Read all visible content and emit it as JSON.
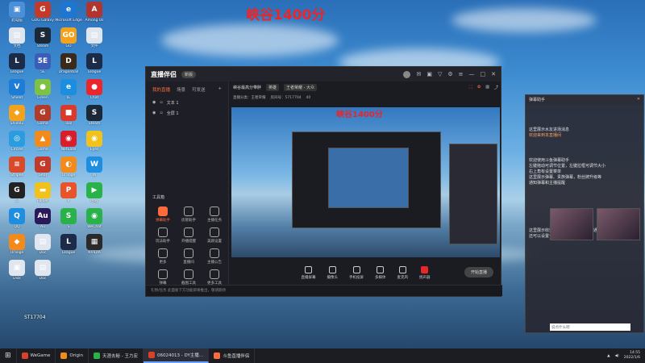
{
  "overlay_title": "峡谷1400分",
  "watermark": "ST17704",
  "desktop_icons": [
    {
      "label": "此电脑",
      "color": "#4a8fd8",
      "glyph": "▣"
    },
    {
      "label": "GOG Galaxy",
      "color": "#c23b2a",
      "glyph": "G"
    },
    {
      "label": "Microsoft Edge",
      "color": "#1d76cf",
      "glyph": "e"
    },
    {
      "label": "Among Us",
      "color": "#b2342e",
      "glyph": "A"
    },
    {
      "label": "文档",
      "color": "#e0e6ef",
      "glyph": "▤"
    },
    {
      "label": "Steam",
      "color": "#1b2838",
      "glyph": "S"
    },
    {
      "label": "GO",
      "color": "#f2a21c",
      "glyph": "GO"
    },
    {
      "label": "文件",
      "color": "#e0e6ef",
      "glyph": "▤"
    },
    {
      "label": "League",
      "color": "#1c2b48",
      "glyph": "L"
    },
    {
      "label": "5E",
      "color": "#3b5db8",
      "glyph": "5E"
    },
    {
      "label": "Dragonball",
      "color": "#3a2a1a",
      "glyph": "D"
    },
    {
      "label": "League",
      "color": "#1c2b48",
      "glyph": "L"
    },
    {
      "label": "Shield",
      "color": "#1c7cd6",
      "glyph": "V"
    },
    {
      "label": "Green",
      "color": "#7dc244",
      "glyph": "●"
    },
    {
      "label": "IE",
      "color": "#1b8ee0",
      "glyph": "e"
    },
    {
      "label": "Chat",
      "color": "#e8262b",
      "glyph": "●"
    },
    {
      "label": "Shield2",
      "color": "#f2a21c",
      "glyph": "◆"
    },
    {
      "label": "Game",
      "color": "#b23a2a",
      "glyph": "G"
    },
    {
      "label": "Tool",
      "color": "#d93a2b",
      "glyph": "■"
    },
    {
      "label": "Steam",
      "color": "#1b2838",
      "glyph": "S"
    },
    {
      "label": "Circles",
      "color": "#2a9cdf",
      "glyph": "◎"
    },
    {
      "label": "Game",
      "color": "#f28a1c",
      "glyph": "▲"
    },
    {
      "label": "NetEase",
      "color": "#d81e2a",
      "glyph": "◉"
    },
    {
      "label": "Eyes",
      "color": "#f2c21c",
      "glyph": "◉"
    },
    {
      "label": "Stripes",
      "color": "#d84a2a",
      "glyph": "≡"
    },
    {
      "label": "Gear",
      "color": "#c23b2a",
      "glyph": "G"
    },
    {
      "label": "Orange",
      "color": "#f28a1c",
      "glyph": "◐"
    },
    {
      "label": "W",
      "color": "#1d8ee0",
      "glyph": "W"
    },
    {
      "label": "G",
      "color": "#222",
      "glyph": "G"
    },
    {
      "label": "Folder",
      "color": "#f2c21c",
      "glyph": "▬"
    },
    {
      "label": "P",
      "color": "#e8532a",
      "glyph": "P"
    },
    {
      "label": "Play",
      "color": "#2ab24a",
      "glyph": "▶"
    },
    {
      "label": "QQ",
      "color": "#1d8ee0",
      "glyph": "Q"
    },
    {
      "label": "Au",
      "color": "#2a1a5a",
      "glyph": "Au"
    },
    {
      "label": "S",
      "color": "#2ab24a",
      "glyph": "S"
    },
    {
      "label": "WeChat",
      "color": "#2ab24a",
      "glyph": "◉"
    },
    {
      "label": "Orange",
      "color": "#f28a1c",
      "glyph": "◆"
    },
    {
      "label": "Doc",
      "color": "#e0e6ef",
      "glyph": "▤"
    },
    {
      "label": "League",
      "color": "#1c2b48",
      "glyph": "L"
    },
    {
      "label": "NVIDIA",
      "color": "#2a2a2a",
      "glyph": "▦"
    },
    {
      "label": "Disk",
      "color": "#e0e6ef",
      "glyph": "▣"
    },
    {
      "label": "Doc",
      "color": "#e0e6ef",
      "glyph": "▤"
    }
  ],
  "app": {
    "logo": "直播伴侣",
    "badge": "新版",
    "tabs": [
      "我的直播",
      "场景",
      "可发送"
    ],
    "scenes": [
      "文本 1",
      "全屏 1"
    ],
    "tools_title": "工具箱",
    "tools": [
      "弹幕助手",
      "房管助手",
      "主播任务",
      "玩法助手",
      "开播提醒",
      "美颜设置",
      "更多",
      "直播间",
      "主播公告",
      "弹幕",
      "截图工具",
      "更多工具"
    ],
    "room_title": "峡谷最高分带胖",
    "room_pill1": "英雄",
    "room_pill2": "王者荣耀 - 大众",
    "info2_a": "直播分类：王者荣耀",
    "info2_b": "房间号：5717704",
    "info2_c": "40",
    "preview_title": "峡谷1400分",
    "bottom_tools": [
      "直播屏幕",
      "摄像头",
      "手机投屏",
      "多媒体",
      "麦克风",
      "扬声器"
    ],
    "start_label": "开始直播",
    "status_text": "礼物/任务   此面板下方功能即将推出，敬请期待"
  },
  "chat": {
    "title": "弹幕助手",
    "lines": [
      {
        "text": "这里展示水友进场消息",
        "orange": false
      },
      {
        "text": "欢迎来到本直播间",
        "orange": true
      },
      {
        "text": "欢迎使用斗鱼弹幕助手",
        "orange": false
      },
      {
        "text": "左键拖动可调节位置，左键拉框可调节大小",
        "orange": false
      },
      {
        "text": "右上角有设置菜单",
        "orange": false
      },
      {
        "text": "这里展示弹幕、贵族弹幕，粉丝牌升级等",
        "orange": false
      },
      {
        "text": "通知弹幕和主播提醒",
        "orange": false
      },
      {
        "text": "这里展示收到的礼物、道具、贵族开通",
        "orange": false
      },
      {
        "text": "还可以设置个性化特效",
        "orange": false
      }
    ],
    "input_placeholder": "说点什么吧"
  },
  "taskbar": {
    "items": [
      {
        "label": "WeGame",
        "color": "#d8412a",
        "active": false
      },
      {
        "label": "Origin",
        "color": "#f28a1c",
        "active": false
      },
      {
        "label": "天涯去秘 - 王力宏",
        "color": "#2ab24a",
        "active": false
      },
      {
        "label": "06024013 - DY主播…",
        "color": "#d8412a",
        "active": true
      },
      {
        "label": "斗鱼直播伴侣",
        "color": "#ff6b3d",
        "active": false
      }
    ],
    "time": "14:55",
    "date": "2022/1/6"
  }
}
